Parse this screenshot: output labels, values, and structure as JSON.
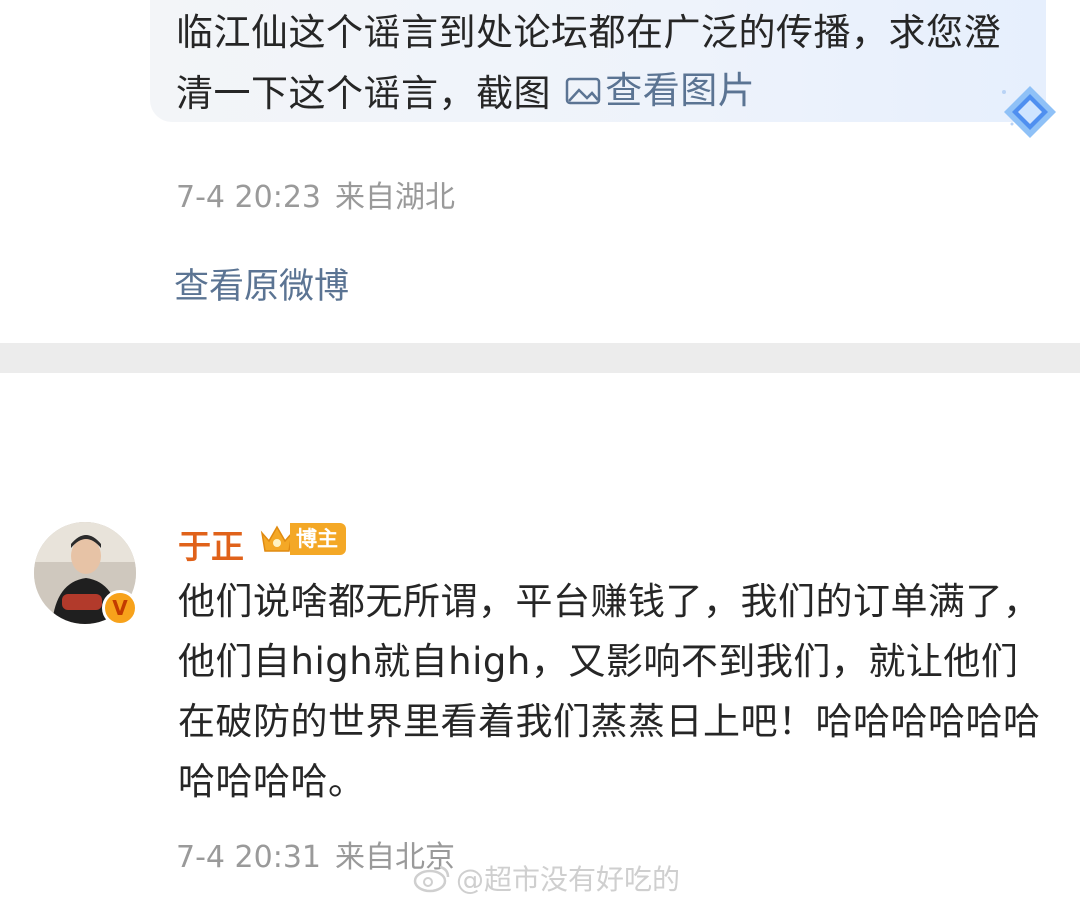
{
  "comment_top": {
    "text": "临江仙这个谣言到处论坛都在广泛的传播，求您澄清一下这个谣言，截图",
    "view_image_label": "查看图片",
    "timestamp": "7-4 20:23",
    "location": "来自湖北",
    "view_original": "查看原微博"
  },
  "reply": {
    "username": "于正",
    "badge_label": "博主",
    "text": "他们说啥都无所谓，平台赚钱了，我们的订单满了，他们自high就自high，又影响不到我们，就让他们在破防的世界里看着我们蒸蒸日上吧！哈哈哈哈哈哈哈哈哈哈。",
    "timestamp": "7-4 20:31",
    "location": "来自北京",
    "verified_mark": "V"
  },
  "watermark": {
    "text": "@超市没有好吃的"
  },
  "colors": {
    "link": "#5b7493",
    "username": "#e0621a",
    "meta": "#9a9a9a",
    "badge": "#f4a826"
  }
}
